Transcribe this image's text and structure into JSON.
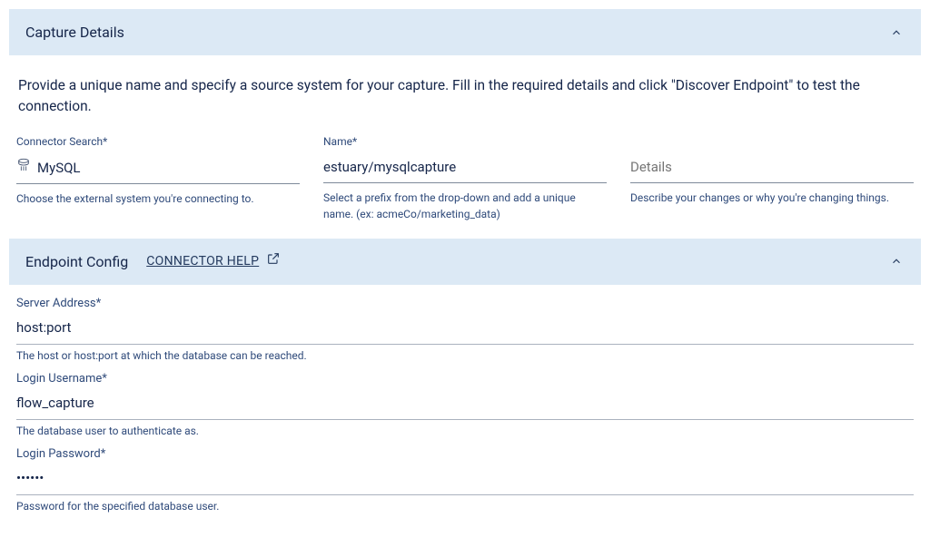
{
  "panels": {
    "details": {
      "title": "Capture Details",
      "intro": "Provide a unique name and specify a source system for your capture. Fill in the required details and click \"Discover Endpoint\" to test the connection.",
      "fields": {
        "connector": {
          "label": "Connector Search*",
          "value": "MySQL",
          "helper": "Choose the external system you're connecting to."
        },
        "name": {
          "label": "Name*",
          "value": "estuary/mysqlcapture",
          "helper": "Select a prefix from the drop-down and add a unique name. (ex: acmeCo/marketing_data)"
        },
        "details": {
          "label": "",
          "placeholder": "Details",
          "helper": "Describe your changes or why you're changing things."
        }
      }
    },
    "endpoint": {
      "title": "Endpoint Config",
      "help_link": "CONNECTOR HELP",
      "fields": {
        "address": {
          "label": "Server Address*",
          "value": "host:port",
          "helper": "The host or host:port at which the database can be reached."
        },
        "username": {
          "label": "Login Username*",
          "value": "flow_capture",
          "helper": "The database user to authenticate as."
        },
        "password": {
          "label": "Login Password*",
          "value": "••••••",
          "helper": "Password for the specified database user."
        }
      }
    }
  }
}
